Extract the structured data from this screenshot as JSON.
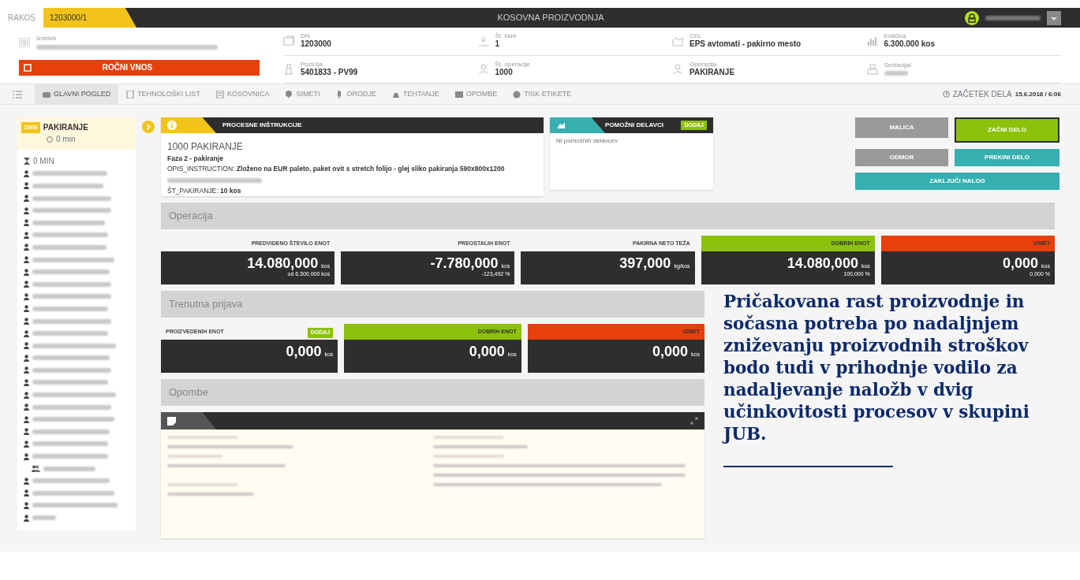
{
  "topbar": {
    "module": "RAKOS",
    "order": "1203000/1",
    "title": "KOSOVNA PROIZVODNJA"
  },
  "header": {
    "product_label": "Izdelek",
    "manual_button": "ROČNI VNOS",
    "fields": [
      {
        "label": "DN",
        "value": "1203000"
      },
      {
        "label": "Št. faze",
        "value": "1"
      },
      {
        "label": "CEL",
        "value": "EPS avtomati - pakirno mesto"
      },
      {
        "label": "Količina",
        "value": "6.300.000 kos"
      },
      {
        "label": "Pozicija",
        "value": "5401833 - PV99"
      },
      {
        "label": "Št. operacije",
        "value": "1000"
      },
      {
        "label": "Operacija",
        "value": "PAKIRANJE"
      },
      {
        "label": "Sestavljal"
      }
    ]
  },
  "tabs": [
    {
      "label": "GLAVNI POGLED",
      "selected": true
    },
    {
      "label": "TEHNOLOŠKI LIST",
      "selected": false
    },
    {
      "label": "KOSOVNICA",
      "selected": false
    },
    {
      "label": "SIMETI",
      "selected": false
    },
    {
      "label": "ORODJE",
      "selected": false
    },
    {
      "label": "TEHTANJE",
      "selected": false
    },
    {
      "label": "OPOMBE",
      "selected": false
    },
    {
      "label": "TISK ETIKETE",
      "selected": false
    }
  ],
  "work_start": {
    "label": "ZAČETEK DELA",
    "value": "15.6.2018 / 6:06"
  },
  "sidebar": {
    "badge": "1000",
    "title": "PAKIRANJE",
    "subtitle": "0 min",
    "summary": "0 MIN",
    "workers": [
      {
        "kind": "worker"
      },
      {
        "kind": "worker"
      },
      {
        "kind": "worker"
      },
      {
        "kind": "worker"
      },
      {
        "kind": "worker"
      },
      {
        "kind": "worker"
      },
      {
        "kind": "worker"
      },
      {
        "kind": "worker"
      },
      {
        "kind": "worker"
      },
      {
        "kind": "worker"
      },
      {
        "kind": "worker"
      },
      {
        "kind": "worker"
      },
      {
        "kind": "worker"
      },
      {
        "kind": "worker"
      },
      {
        "kind": "worker"
      },
      {
        "kind": "worker"
      },
      {
        "kind": "worker"
      },
      {
        "kind": "worker"
      },
      {
        "kind": "worker"
      },
      {
        "kind": "worker"
      },
      {
        "kind": "worker"
      },
      {
        "kind": "worker"
      },
      {
        "kind": "worker"
      },
      {
        "kind": "worker",
        "children": [
          {
            "kind": "helper"
          }
        ]
      },
      {
        "kind": "worker"
      },
      {
        "kind": "worker"
      },
      {
        "kind": "worker"
      },
      {
        "kind": "worker"
      }
    ]
  },
  "instructions": {
    "title": "PROCESNE INŠTRUKCIJE",
    "heading": "1000 PAKIRANJE",
    "lines": [
      {
        "text": "Faza 2 - pakiranje",
        "kind": "bold"
      },
      {
        "text": "OPIS_INSTRUCTION: **Zloženo na EUR paleto, paket ovit s stretch folijo - glej sliko pakiranja 590x800x1200**",
        "kind": "text"
      },
      {
        "kind": "blurred"
      },
      {
        "text": "ŠT_PAKIRANJE: **10 kos**",
        "kind": "text"
      }
    ]
  },
  "helpers": {
    "title": "POMOŽNI DELAVCI",
    "add_button": "DODAJ",
    "empty_text": "Ni pomožnih delavcev"
  },
  "actions": [
    {
      "label": "MALICA",
      "color": "#9a9a9a",
      "selected": false
    },
    {
      "label": "ZAČNI DELO",
      "color": "#8cc20a",
      "selected": true
    },
    {
      "label": "ODMOR",
      "color": "#9a9a9a",
      "selected": false
    },
    {
      "label": "PREKINI DELO",
      "color": "#36b0b0",
      "selected": false
    },
    {
      "label": "ZAKLJUČI NALOG",
      "color": "#36b0b0",
      "selected": false
    }
  ],
  "operation": {
    "title": "Operacija",
    "cards": [
      {
        "label": "PREDVIDENO ŠTEVILO ENOT",
        "value": "14.080,000",
        "unit": "kos",
        "sub": "od 6.300,000 kos"
      },
      {
        "label": "PREOSTALIH ENOT",
        "value": "-7.780,000",
        "unit": "kos",
        "sub": "-123,492 %"
      },
      {
        "label": "PAKIRNA NETO TEŽA",
        "value": "397,000",
        "unit": "kg/kos"
      },
      {
        "label": "DOBRIH ENOT",
        "value": "14.080,000",
        "unit": "kos",
        "sub": "100,000 %",
        "color": "#8cc20a"
      },
      {
        "label": "IZMET",
        "value": "0,000",
        "unit": "kos",
        "sub": "0,000 %",
        "color": "#e8400c"
      }
    ]
  },
  "current": {
    "title": "Trenutna prijava",
    "cards": [
      {
        "label": "PROIZVEDENIH ENOT",
        "badge": "DODAJ",
        "value": "0,000",
        "unit": "kos"
      },
      {
        "label": "DOBRIH ENOT",
        "value": "0,000",
        "unit": "kos",
        "color": "#8cc20a"
      },
      {
        "label": "IZMET",
        "value": "0,000",
        "unit": "kos",
        "color": "#e8400c"
      }
    ]
  },
  "notes": {
    "title": "Opombe"
  },
  "quote": "Pričakovana rast proizvodnje in sočasna potreba po nadaljnjem zniževanju proizvodnih stroškov bodo tudi v prihodnje vodilo za nadaljevanje naložb v dvig učinkovitosti procesov v skupini JUB."
}
